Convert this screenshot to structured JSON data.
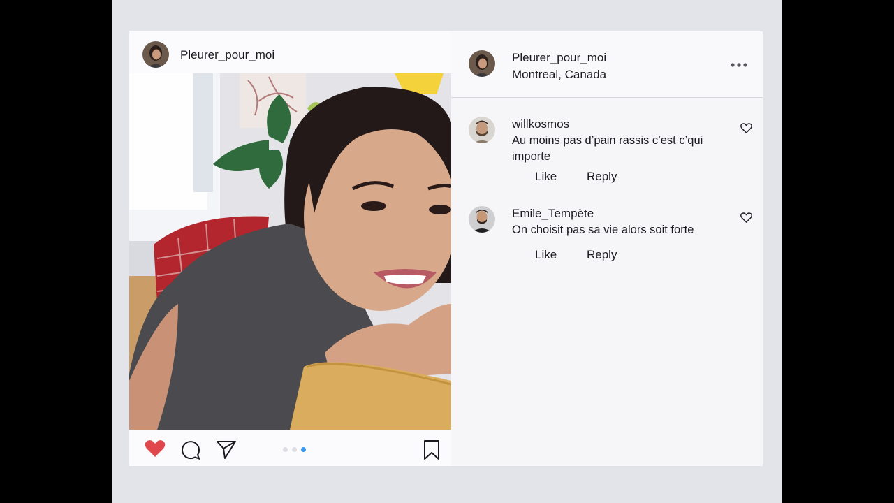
{
  "post": {
    "username": "Pleurer_pour_moi",
    "liked": true,
    "carousel": {
      "count": 3,
      "active_index": 2
    },
    "icons": {
      "like": "heart-icon",
      "comment": "comment-icon",
      "share": "send-icon",
      "save": "bookmark-icon"
    }
  },
  "comments_panel": {
    "username": "Pleurer_pour_moi",
    "location": "Montreal, Canada",
    "more_icon": "more-options-icon",
    "comments": [
      {
        "user": "willkosmos",
        "text": "Au moins pas d’pain rassis c’est c’qui importe",
        "like_label": "Like",
        "reply_label": "Reply"
      },
      {
        "user": "Emile_Tempète",
        "text": "On choisit pas sa vie alors soit forte",
        "like_label": "Like",
        "reply_label": "Reply"
      }
    ]
  },
  "colors": {
    "heart": "#e0474c",
    "active_dot": "#3897f0",
    "background": "#e3e3ea"
  }
}
